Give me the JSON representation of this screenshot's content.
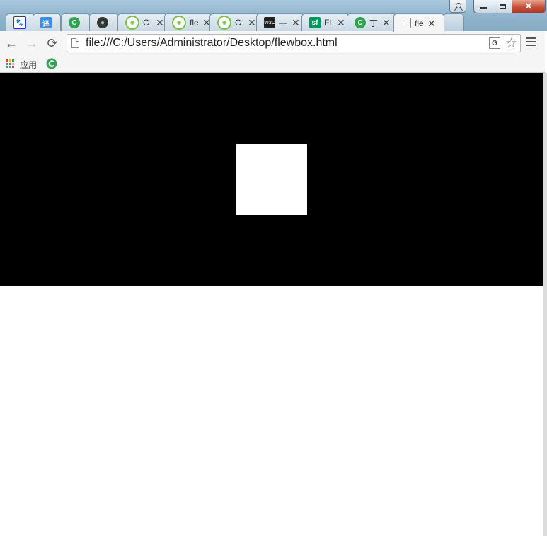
{
  "browser": {
    "tabs": [
      {
        "favicon": "baidu-paw-icon",
        "title": "",
        "color": "#2932e1"
      },
      {
        "favicon": "translate-icon",
        "title": "",
        "color": "#3a8ee6"
      },
      {
        "favicon": "c-logo-icon",
        "title": "",
        "color": "#2ea44f"
      },
      {
        "favicon": "dark-globe-icon",
        "title": "",
        "color": "#333333"
      },
      {
        "favicon": "eye-icon",
        "title": "C",
        "color": "#7cc242"
      },
      {
        "favicon": "eye-icon",
        "title": "fle",
        "color": "#7cc242"
      },
      {
        "favicon": "eye-icon",
        "title": "C",
        "color": "#7cc242"
      },
      {
        "favicon": "w3c-icon",
        "title": "—",
        "color": "#222222"
      },
      {
        "favicon": "sf-icon",
        "title": "Fl",
        "color": "#009a61"
      },
      {
        "favicon": "c-logo-icon",
        "title": "丁",
        "color": "#2ea44f"
      },
      {
        "favicon": "page-icon",
        "title": "fle",
        "color": "#888888",
        "active": true
      }
    ],
    "address_bar": {
      "url": "file:///C:/Users/Administrator/Desktop/flewbox.html"
    },
    "bookmarks": {
      "apps_label": "应用"
    }
  },
  "page": {
    "container_color": "#000000",
    "item_color": "#ffffff"
  }
}
